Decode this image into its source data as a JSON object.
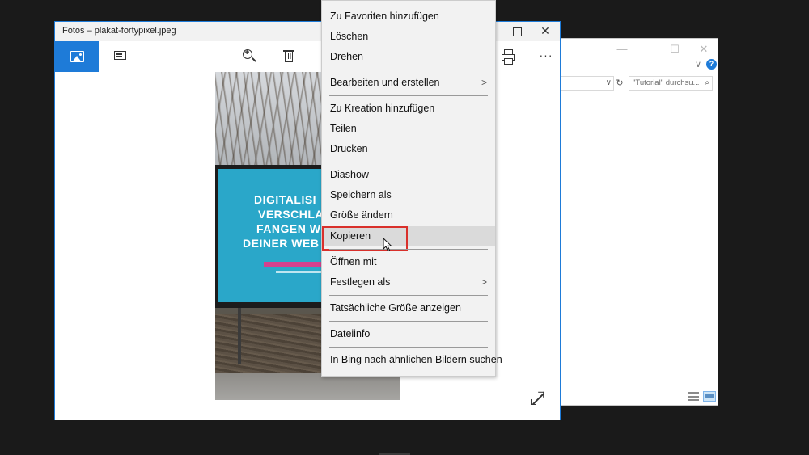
{
  "explorer": {
    "minimize": "—",
    "maximize": "☐",
    "close": "✕",
    "search_placeholder": "\"Tutorial\" durchsu..."
  },
  "photos": {
    "title": "Fotos – plakat-fortypixel.jpeg",
    "more_label": "···",
    "close_label": "✕",
    "accent": "#1e7bd8"
  },
  "photo": {
    "billboard_lines": [
      "DIGITALISI",
      "VERSCHLA",
      "FANGEN W",
      "DEINER WEB"
    ]
  },
  "context_menu": {
    "items": [
      {
        "label": "Zu Favoriten hinzufügen"
      },
      {
        "label": "Löschen"
      },
      {
        "label": "Drehen"
      },
      {
        "label": "Bearbeiten und erstellen",
        "submenu": ">"
      },
      {
        "label": "Zu Kreation hinzufügen"
      },
      {
        "label": "Teilen"
      },
      {
        "label": "Drucken"
      },
      {
        "label": "Diashow"
      },
      {
        "label": "Speichern als"
      },
      {
        "label": "Größe ändern"
      },
      {
        "label": "Kopieren"
      },
      {
        "label": "Öffnen mit"
      },
      {
        "label": "Festlegen als",
        "submenu": ">"
      },
      {
        "label": "Tatsächliche Größe anzeigen"
      },
      {
        "label": "Dateiinfo"
      },
      {
        "label": "In Bing nach ähnlichen Bildern suchen"
      }
    ],
    "highlight_color": "#d9302b",
    "hover_color": "#dadada"
  }
}
